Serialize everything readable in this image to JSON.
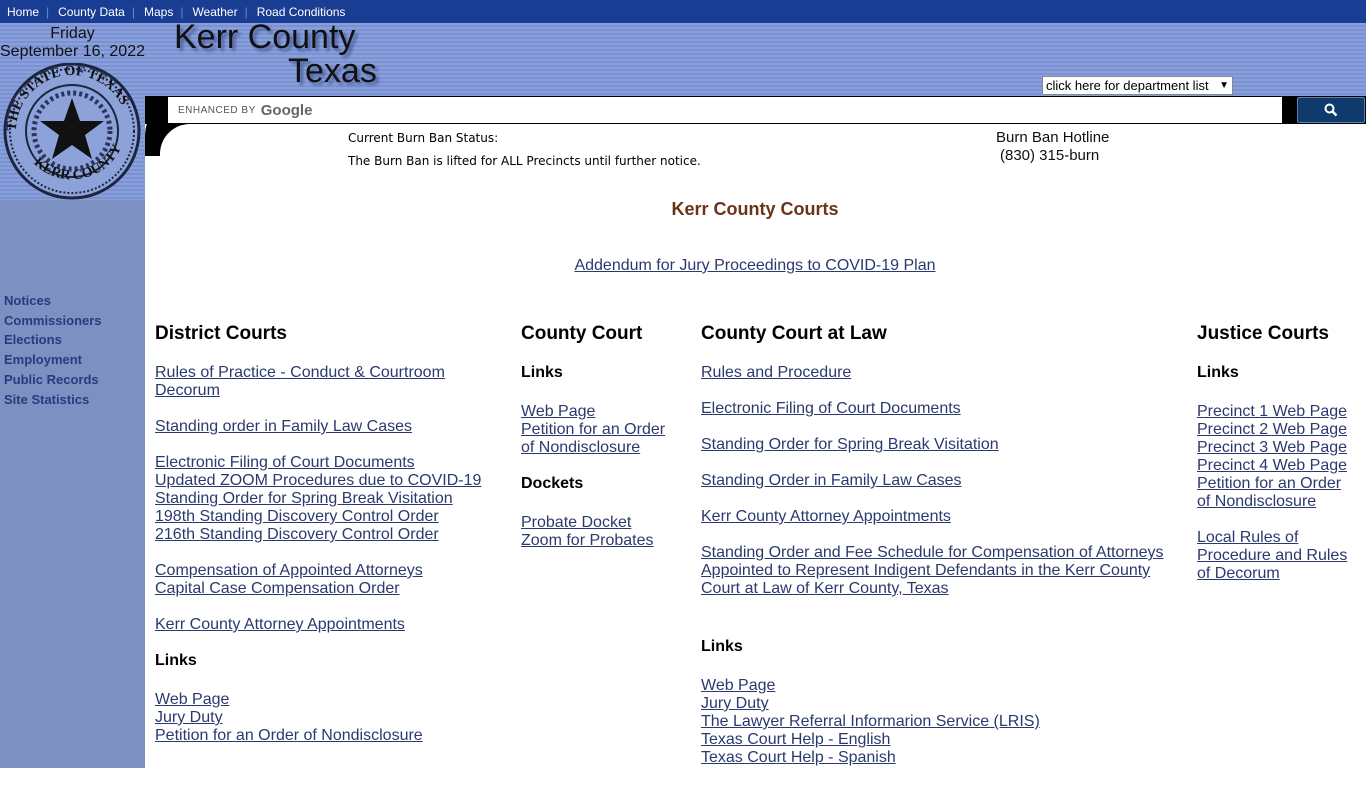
{
  "topnav": [
    "Home",
    "County Data",
    "Maps",
    "Weather",
    "Road Conditions"
  ],
  "date": {
    "day": "Friday",
    "full": "September 16, 2022"
  },
  "seal_text": "THE STATE OF TEXAS KERR COUNTY",
  "logo": {
    "line1": "Kerr County",
    "line2": "Texas"
  },
  "department_select": "click here for department list",
  "search": {
    "enhanced_by": "ENHANCED BY",
    "brand": "Google",
    "button_icon": "search-icon"
  },
  "burn_ban": {
    "label": "Current Burn Ban Status:",
    "status": "The Burn Ban is lifted for ALL Precincts until further notice.",
    "hotline_label": "Burn Ban Hotline",
    "hotline_number": "(830) 315-burn"
  },
  "sidebar": [
    "Notices",
    "Commissioners",
    "Elections",
    "Employment",
    "Public Records",
    "Site Statistics"
  ],
  "page_title": "Kerr County Courts",
  "addendum": "Addendum for Jury Proceedings to COVID-19 Plan",
  "colors": {
    "nav": "#1a3d94",
    "link": "#2b3a6e",
    "title": "#6a3418",
    "sidebar": "#7c90c2"
  },
  "columns": [
    {
      "title": "District Courts",
      "blocks": [
        {
          "links": [
            "Rules of Practice - Conduct & Courtroom Decorum"
          ]
        },
        {
          "links": [
            "Standing order in Family Law Cases"
          ]
        },
        {
          "links": [
            "Electronic Filing of Court Documents",
            "Updated ZOOM Procedures due to COVID-19",
            "Standing Order for Spring Break Visitation",
            "198th Standing Discovery Control Order",
            "216th Standing Discovery Control Order"
          ]
        },
        {
          "links": [
            "Compensation of Appointed Attorneys",
            "Capital Case Compensation Order"
          ]
        },
        {
          "links": [
            "Kerr County Attorney Appointments"
          ]
        },
        {
          "heading": "Links"
        },
        {
          "links": [
            "Web Page",
            "Jury Duty",
            "Petition for an Order of Nondisclosure"
          ]
        }
      ]
    },
    {
      "title": "County Court",
      "blocks": [
        {
          "heading": "Links"
        },
        {
          "links": [
            "Web Page",
            "Petition for an Order of Nondisclosure"
          ]
        },
        {
          "heading": "Dockets"
        },
        {
          "links": [
            "Probate Docket",
            "Zoom for Probates"
          ]
        }
      ]
    },
    {
      "title": "County Court at Law",
      "blocks": [
        {
          "links": [
            "Rules and Procedure"
          ]
        },
        {
          "links": [
            "Electronic Filing of Court Documents"
          ]
        },
        {
          "links": [
            "Standing Order for Spring Break Visitation"
          ]
        },
        {
          "links": [
            "Standing Order in Family Law Cases"
          ]
        },
        {
          "links": [
            "Kerr County Attorney Appointments"
          ]
        },
        {
          "links": [
            "Standing Order and Fee Schedule for Compensation of Attorneys Appointed to Represent Indigent Defendants in the Kerr County Court at Law of Kerr County, Texas"
          ]
        },
        {
          "heading": "Links"
        },
        {
          "links": [
            "Web Page",
            "Jury Duty",
            "The Lawyer Referral Informarion Service (LRIS)",
            "Texas Court Help - English",
            "Texas Court Help - Spanish"
          ]
        }
      ]
    },
    {
      "title": "Justice Courts",
      "blocks": [
        {
          "heading": "Links"
        },
        {
          "links": [
            "Precinct 1 Web Page",
            "Precinct 2 Web Page",
            "Precinct 3 Web Page",
            "Precinct 4 Web Page",
            "Petition for an Order of Nondisclosure"
          ]
        },
        {
          "links": [
            "Local Rules of Procedure and Rules of Decorum"
          ]
        }
      ]
    }
  ]
}
